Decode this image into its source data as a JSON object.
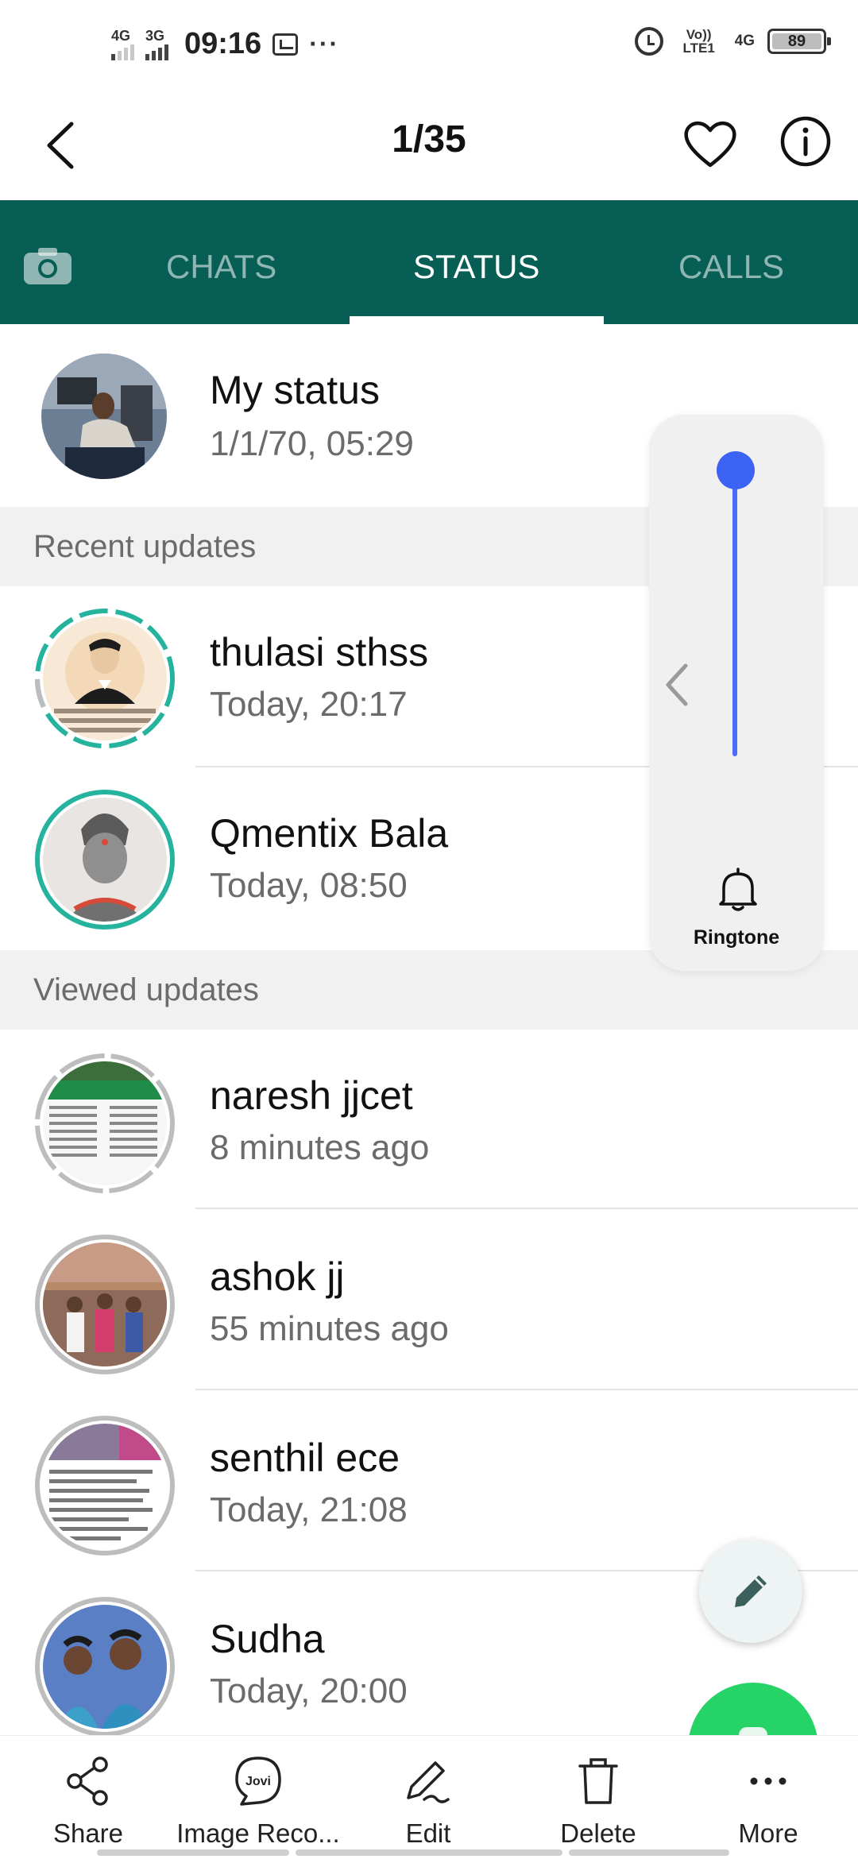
{
  "status_bar": {
    "network_1": "4G",
    "network_2": "3G",
    "time": "09:16",
    "more": "···",
    "volte": "Vo)) LTE1",
    "network_3": "4G",
    "battery": "89"
  },
  "viewer": {
    "counter": "1/35"
  },
  "whatsapp": {
    "tabs": [
      {
        "label": "CHATS",
        "active": false
      },
      {
        "label": "STATUS",
        "active": true
      },
      {
        "label": "CALLS",
        "active": false
      }
    ],
    "my_status": {
      "name": "My status",
      "time": "1/1/70, 05:29"
    },
    "recent_header": "Recent updates",
    "recent": [
      {
        "name": "thulasi sthss",
        "time": "Today, 20:17"
      },
      {
        "name": "Qmentix Bala",
        "time": "Today, 08:50"
      }
    ],
    "viewed_header": "Viewed updates",
    "viewed": [
      {
        "name": "naresh jjcet",
        "time": "8 minutes ago"
      },
      {
        "name": "ashok jj",
        "time": "55 minutes ago"
      },
      {
        "name": "senthil ece",
        "time": "Today, 21:08"
      },
      {
        "name": "Sudha",
        "time": "Today, 20:00"
      }
    ]
  },
  "volume_panel": {
    "label": "Ringtone",
    "level": 1.0
  },
  "actions": [
    {
      "label": "Share",
      "icon": "share-icon"
    },
    {
      "label": "Image Reco...",
      "icon": "jovi-icon"
    },
    {
      "label": "Edit",
      "icon": "edit-icon"
    },
    {
      "label": "Delete",
      "icon": "trash-icon"
    },
    {
      "label": "More",
      "icon": "more-icon"
    }
  ],
  "colors": {
    "header_green": "#075e54",
    "ring_teal": "#25b39e",
    "ring_viewed": "#bdbdbd",
    "volume_blue": "#3d63f5",
    "fab_green": "#25d366"
  }
}
